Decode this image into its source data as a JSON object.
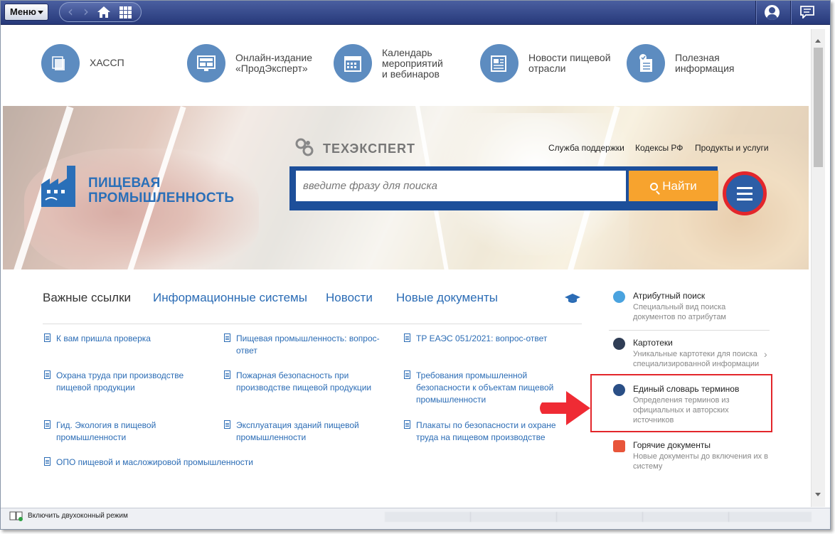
{
  "toolbar": {
    "menu_label": "Меню"
  },
  "quick_links": [
    {
      "label": "ХАССП",
      "icon": "folders-icon"
    },
    {
      "label": "Онлайн-издание\n«ПродЭксперт»",
      "icon": "monitor-icon"
    },
    {
      "label": "Календарь\nмероприятий\nи вебинаров",
      "icon": "calendar-icon"
    },
    {
      "label": "Новости пищевой\nотрасли",
      "icon": "newspaper-icon"
    },
    {
      "label": "Полезная\nинформация",
      "icon": "info-doc-icon"
    }
  ],
  "banner": {
    "texpert_logo": "ТЕХЭКСПЕRТ",
    "top_links": [
      "Служба поддержки",
      "Кодексы РФ",
      "Продукты и услуги"
    ],
    "brand": "ПИЩЕВАЯ\nПРОМЫШЛЕННОСТЬ",
    "search_placeholder": "введите фразу для поиска",
    "search_button": "Найти"
  },
  "tabs": [
    "Важные ссылки",
    "Информационные системы",
    "Новости",
    "Новые документы"
  ],
  "links": [
    "К вам пришла проверка",
    "Пищевая промышленность: вопрос-ответ",
    "ТР ЕАЭС 051/2021: вопрос-ответ",
    "Охрана труда при производстве пищевой продукции",
    "Пожарная безопасность при производстве пищевой продукции",
    "Требования промышленной безопасности к объектам пищевой промышленности",
    "Гид. Экология в пищевой промышленности",
    "Эксплуатация зданий пищевой промышленности",
    "Плакаты по безопасности и охране труда на пищевом производстве",
    "ОПО пищевой и масложировой промышленности"
  ],
  "right_panel": [
    {
      "title": "Атрибутный поиск",
      "desc": "Специальный вид поиска документов по атрибутам",
      "color": "#4aa3df"
    },
    {
      "title": "Картотеки",
      "desc": "Уникальные картотеки для поиска специализированной информации",
      "color": "#2f3d55"
    },
    {
      "title": "Единый словарь терминов",
      "desc": "Определения терминов из официальных и авторских источников",
      "color": "#2a4f86"
    },
    {
      "title": "Горячие документы",
      "desc": "Новые документы до включения их в систему",
      "color": "#e8553a"
    }
  ],
  "statusbar": {
    "dual_mode": "Включить двухоконный режим"
  },
  "colors": {
    "toolbar": "#27397a",
    "accent_blue": "#2b6cb5",
    "search_button": "#f7a32e",
    "highlight": "#e3262b"
  }
}
